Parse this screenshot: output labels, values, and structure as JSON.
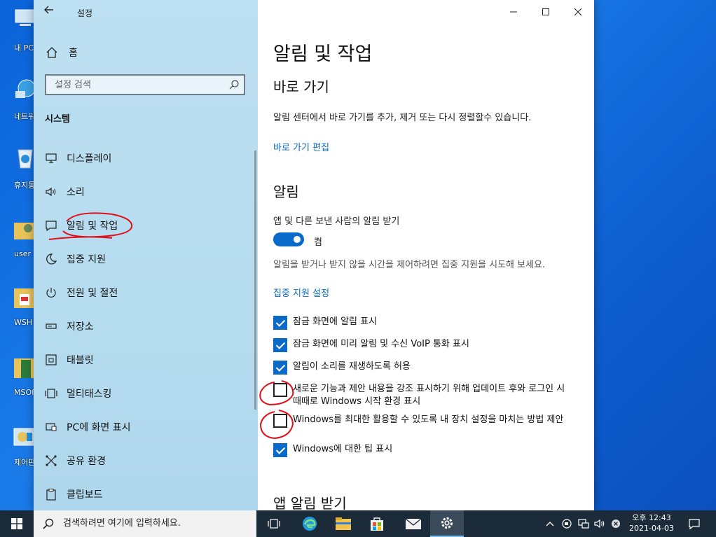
{
  "desktop": {
    "icons": [
      {
        "label": "내 PC",
        "icon": "computer-icon"
      },
      {
        "label": "네트워크",
        "icon": "network-icon"
      },
      {
        "label": "휴지통",
        "icon": "recycle-bin-icon"
      },
      {
        "label": "user",
        "icon": "user-folder-icon"
      },
      {
        "label": "WSH",
        "icon": "pdf-file-icon"
      },
      {
        "label": "MSOffice",
        "icon": "office-icon"
      },
      {
        "label": "제어판",
        "icon": "control-panel-icon"
      }
    ]
  },
  "window": {
    "title": "설정",
    "sidebar": {
      "home_label": "홈",
      "search_placeholder": "설정 검색",
      "section_label": "시스템",
      "items": [
        {
          "label": "디스플레이",
          "icon": "display-icon"
        },
        {
          "label": "소리",
          "icon": "speaker-icon"
        },
        {
          "label": "알림 및 작업",
          "icon": "notification-icon"
        },
        {
          "label": "집중 지원",
          "icon": "moon-icon"
        },
        {
          "label": "전원 및 절전",
          "icon": "power-icon"
        },
        {
          "label": "저장소",
          "icon": "storage-icon"
        },
        {
          "label": "태블릿",
          "icon": "tablet-icon"
        },
        {
          "label": "멀티태스킹",
          "icon": "multitasking-icon"
        },
        {
          "label": "PC에 화면 표시",
          "icon": "project-icon"
        },
        {
          "label": "공유 환경",
          "icon": "share-icon"
        },
        {
          "label": "클립보드",
          "icon": "clipboard-icon"
        }
      ]
    },
    "content": {
      "page_title": "알림 및 작업",
      "shortcuts_heading": "바로 가기",
      "shortcuts_desc": "알림 센터에서 바로 가기를 추가, 제거 또는 다시 정렬할수 있습니다.",
      "shortcuts_link": "바로 가기 편집",
      "notifications_heading": "알림",
      "toggle_label": "앱 및 다른 보낸 사람의 알림 받기",
      "toggle_state": "켬",
      "focus_desc": "알림을 받거나 받지 않을 시간을 제어하려면 집중 지원을 시도해 보세요.",
      "focus_link": "집중 지원 설정",
      "checkboxes": [
        {
          "label": "잠금 화면에 알림 표시",
          "checked": true
        },
        {
          "label": "잠금 화면에 미리 알림 및 수신 VoIP 통화 표시",
          "checked": true
        },
        {
          "label": "알림이 소리를 재생하도록 허용",
          "checked": true
        },
        {
          "label": "새로운 기능과 제안 내용을 강조 표시하기 위해 업데이트 후와 로그인 시 때때로 Windows 시작 환경 표시",
          "checked": false
        },
        {
          "label": "Windows를 최대한 활용할 수 있도록 내 장치 설정을 마치는 방법 제안",
          "checked": false
        },
        {
          "label": "Windows에 대한 팁 표시",
          "checked": true
        }
      ],
      "app_notifications_heading": "앱 알림 받기"
    }
  },
  "taskbar": {
    "search_placeholder": "검색하려면 여기에 입력하세요.",
    "clock_time": "오후 12:43",
    "clock_date": "2021-04-03"
  },
  "colors": {
    "accent": "#0a6ac9",
    "sidebar_bg": "#b6dcef",
    "annotation_red": "#e0101a"
  }
}
